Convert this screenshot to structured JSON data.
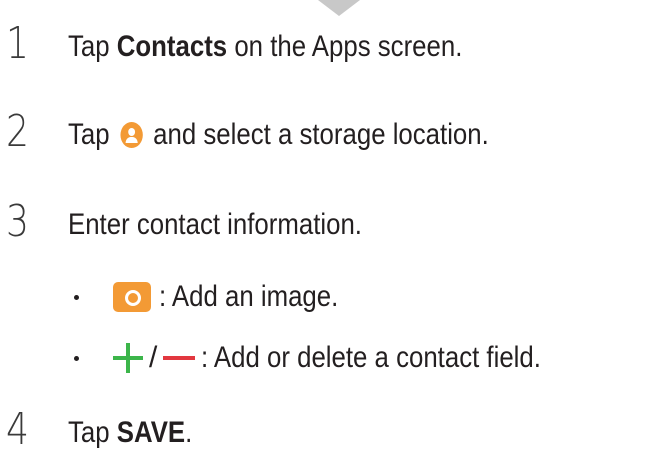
{
  "steps": [
    {
      "number": "1",
      "prefix": "Tap ",
      "bold": "Contacts",
      "suffix": " on the Apps screen."
    },
    {
      "number": "2",
      "prefix": "Tap ",
      "suffix": " and select a storage location.",
      "icon": "add-contact-icon"
    },
    {
      "number": "3",
      "text": "Enter contact information."
    },
    {
      "number": "4",
      "prefix": "Tap ",
      "bold": "SAVE",
      "suffix": "."
    }
  ],
  "bullets": [
    {
      "icon": "camera-icon",
      "text": ": Add an image."
    },
    {
      "icons": [
        "plus-icon",
        "minus-icon"
      ],
      "separator": "/",
      "text": ": Add or delete a contact field."
    }
  ],
  "colors": {
    "orange": "#f39a35",
    "green": "#3cb54a",
    "red": "#e2373f",
    "arrow": "#c8c8c8"
  }
}
